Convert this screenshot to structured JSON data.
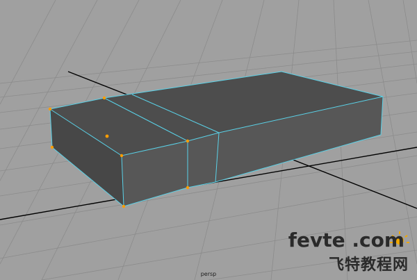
{
  "viewport": {
    "camera_label": "persp"
  },
  "watermark": {
    "site": "fevte .com",
    "name_cn": "飞特教程网"
  },
  "colors": {
    "background": "#a0a0a0",
    "grid": "#8a8a8a",
    "axis": "#000000",
    "wireframe": "#5ad2e8",
    "vertex": "#ff9d00",
    "face_top": "#4b4b4b",
    "face_front": "#555555",
    "face_side": "#454545"
  },
  "mesh": {
    "object": "poly-box",
    "selection_mode": "vertex"
  }
}
